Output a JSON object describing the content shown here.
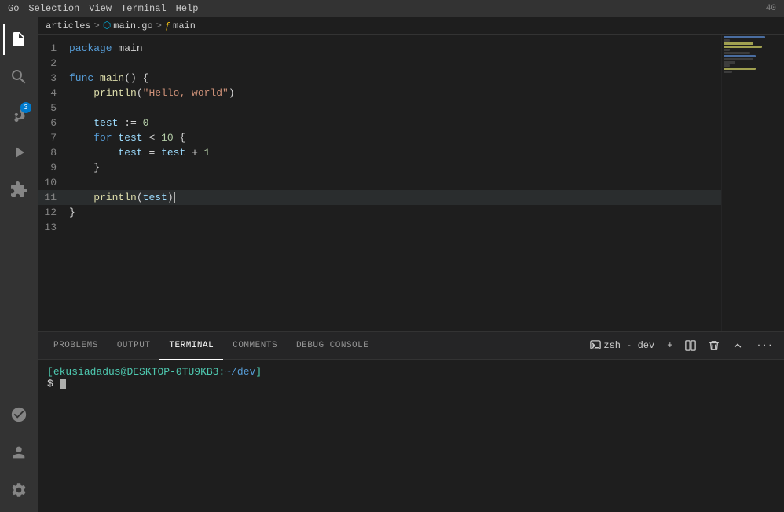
{
  "topbar": {
    "items": [
      "Go",
      "Selection",
      "View",
      "Terminal",
      "Help"
    ],
    "right": "40"
  },
  "breadcrumb": {
    "parts": [
      "articles",
      "main.go",
      "main"
    ],
    "separators": [
      ">",
      ">"
    ]
  },
  "editor": {
    "lines": [
      {
        "num": 1,
        "content": "package main",
        "type": "package"
      },
      {
        "num": 2,
        "content": "",
        "type": "empty"
      },
      {
        "num": 3,
        "content": "func main() {",
        "type": "func"
      },
      {
        "num": 4,
        "content": "    println(\"Hello, world\")",
        "type": "call"
      },
      {
        "num": 5,
        "content": "",
        "type": "empty"
      },
      {
        "num": 6,
        "content": "    test := 0",
        "type": "assign"
      },
      {
        "num": 7,
        "content": "    for test < 10 {",
        "type": "for"
      },
      {
        "num": 8,
        "content": "        test = test + 1",
        "type": "assign"
      },
      {
        "num": 9,
        "content": "    }",
        "type": "brace"
      },
      {
        "num": 10,
        "content": "",
        "type": "empty"
      },
      {
        "num": 11,
        "content": "    println(test)",
        "type": "call_cursor"
      },
      {
        "num": 12,
        "content": "}",
        "type": "brace"
      },
      {
        "num": 13,
        "content": "",
        "type": "empty"
      }
    ]
  },
  "panel": {
    "tabs": [
      {
        "id": "problems",
        "label": "PROBLEMS"
      },
      {
        "id": "output",
        "label": "OUTPUT"
      },
      {
        "id": "terminal",
        "label": "TERMINAL"
      },
      {
        "id": "comments",
        "label": "COMMENTS"
      },
      {
        "id": "debug",
        "label": "DEBUG CONSOLE"
      }
    ],
    "active_tab": "terminal",
    "toolbar": {
      "shell_label": "zsh - dev",
      "add": "+",
      "split": "⊟",
      "trash": "🗑",
      "collapse": "∧",
      "more": "..."
    },
    "terminal": {
      "prompt_user": "ekusiadadus",
      "prompt_at": "@",
      "prompt_host": "DESKTOP-0TU9KB3",
      "prompt_colon": ":",
      "prompt_path": "~/dev",
      "prompt_close": "]",
      "prompt_symbol": "$"
    }
  },
  "activity_bar": {
    "icons": [
      {
        "name": "files-icon",
        "symbol": "⎘",
        "active": true
      },
      {
        "name": "search-icon",
        "symbol": "🔍",
        "active": false
      },
      {
        "name": "source-control-icon",
        "symbol": "⑂",
        "active": false,
        "badge": "3"
      },
      {
        "name": "run-icon",
        "symbol": "▷",
        "active": false
      },
      {
        "name": "extensions-icon",
        "symbol": "⊞",
        "active": false
      }
    ],
    "bottom": [
      {
        "name": "accounts-icon",
        "symbol": "👤"
      },
      {
        "name": "settings-icon",
        "symbol": "⚙"
      }
    ]
  }
}
